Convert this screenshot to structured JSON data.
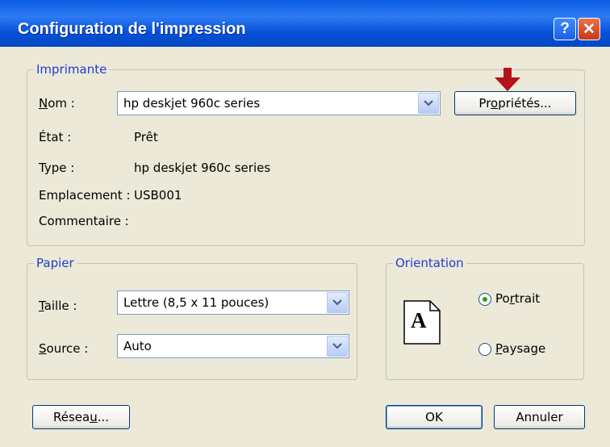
{
  "window": {
    "title": "Configuration de l'impression",
    "help_label": "?",
    "close_label": "✕"
  },
  "printer": {
    "legend": "Imprimante",
    "name_label_u": "N",
    "name_label_rest": "om :",
    "name_value": "hp deskjet 960c series",
    "properties_pre": "Pr",
    "properties_u": "o",
    "properties_post": "priétés...",
    "status_label": "État :",
    "status_value": "Prêt",
    "type_label": "Type :",
    "type_value": "hp deskjet 960c series",
    "location_label": "Emplacement :",
    "location_value": "USB001",
    "comment_label": "Commentaire :"
  },
  "paper": {
    "legend": "Papier",
    "size_label_u": "T",
    "size_label_rest": "aille :",
    "size_value": "Lettre (8,5 x 11 pouces)",
    "source_label_u": "S",
    "source_label_rest": "ource :",
    "source_value": "Auto"
  },
  "orientation": {
    "legend": "Orientation",
    "page_glyph": "A",
    "portrait_pre": "Po",
    "portrait_u": "r",
    "portrait_post": "trait",
    "portrait_selected": true,
    "landscape_u": "P",
    "landscape_rest": "aysage"
  },
  "buttons": {
    "network_pre": "Résea",
    "network_u": "u",
    "network_post": "...",
    "ok": "OK",
    "cancel": "Annuler"
  },
  "annotation": {
    "arrow_color": "#B5121B"
  },
  "colors": {
    "group_legend": "#1F3DD1",
    "dialog_bg": "#ECE9D8",
    "titlebar": "#0A5BE0"
  }
}
